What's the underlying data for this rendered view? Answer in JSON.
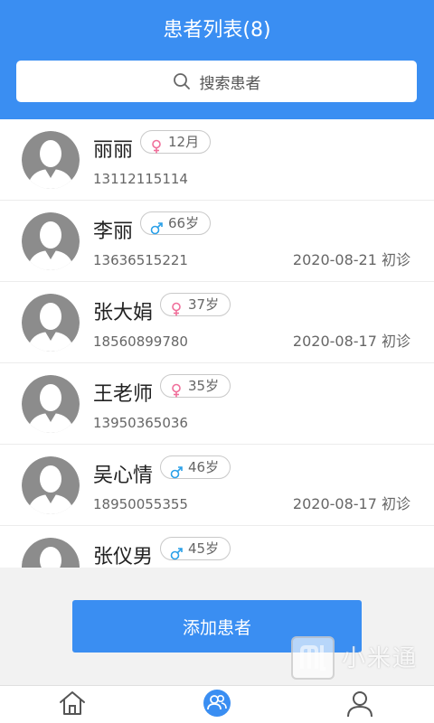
{
  "header": {
    "title": "患者列表(8)"
  },
  "search": {
    "placeholder": "搜索患者",
    "icon": "search-icon"
  },
  "colors": {
    "primary": "#3a8ef2",
    "female": "#f06e9a",
    "male": "#2aa0e8"
  },
  "patients": [
    {
      "name": "丽丽",
      "gender": "female",
      "age": "12月",
      "phone": "13112115114",
      "date": ""
    },
    {
      "name": "李丽",
      "gender": "male",
      "age": "66岁",
      "phone": "13636515221",
      "date": "2020-08-21 初诊"
    },
    {
      "name": "张大娟",
      "gender": "female",
      "age": "37岁",
      "phone": "18560899780",
      "date": "2020-08-17 初诊"
    },
    {
      "name": "王老师",
      "gender": "female",
      "age": "35岁",
      "phone": "13950365036",
      "date": ""
    },
    {
      "name": "吴心情",
      "gender": "male",
      "age": "46岁",
      "phone": "18950055355",
      "date": "2020-08-17 初诊"
    },
    {
      "name": "张仪男",
      "gender": "male",
      "age": "45岁",
      "phone": "",
      "date": ""
    }
  ],
  "actions": {
    "add_label": "添加患者"
  },
  "tabbar": {
    "items": [
      {
        "icon": "home-icon"
      },
      {
        "icon": "patients-icon",
        "active": true
      },
      {
        "icon": "profile-icon"
      }
    ]
  },
  "watermark": {
    "text": "小米通"
  }
}
